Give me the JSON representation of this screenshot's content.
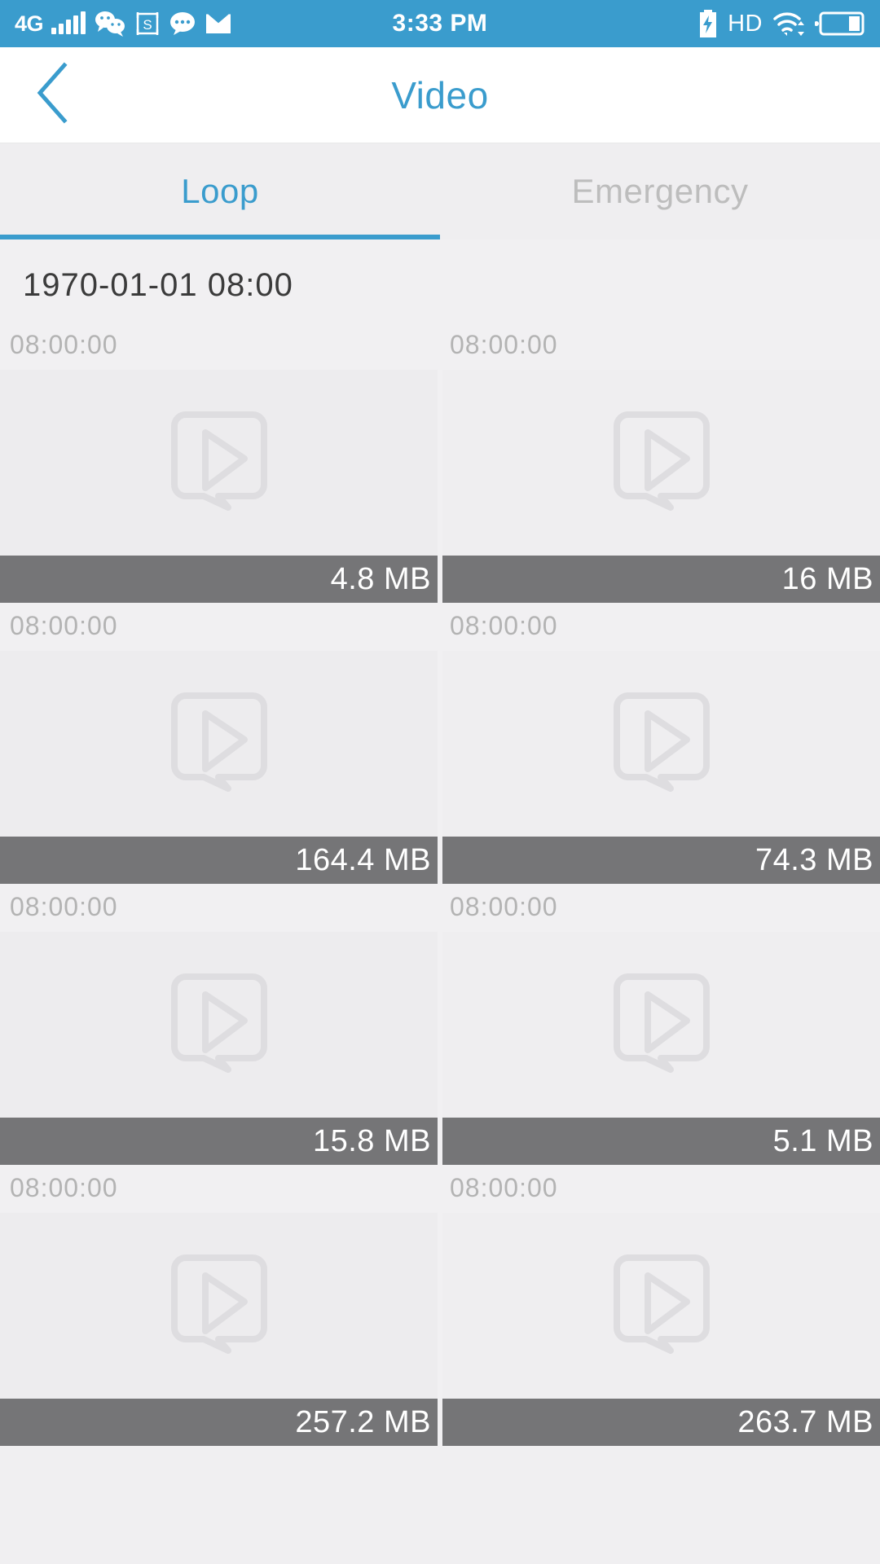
{
  "status_bar": {
    "network_type": "4G",
    "signal_icon": "signal-bars-icon",
    "wechat_icon": "wechat-icon",
    "sogou_icon": "sogou-input-icon",
    "sogou_letter": "S",
    "message_icon": "chat-bubble-icon",
    "mail_icon": "mail-icon",
    "time": "3:33 PM",
    "charging_icon": "battery-charging-icon",
    "hd_label": "HD",
    "wifi_icon": "wifi-icon",
    "battery_icon": "battery-icon",
    "background_color": "#3a9ccd"
  },
  "header": {
    "back_icon": "back-chevron-icon",
    "title": "Video",
    "accent_color": "#3a9ccd"
  },
  "tabs": [
    {
      "label": "Loop",
      "active": true
    },
    {
      "label": "Emergency",
      "active": false
    }
  ],
  "groups": [
    {
      "date": "1970-01-01 08:00",
      "items": [
        {
          "time": "08:00:00",
          "size": "4.8 MB",
          "thumb_icon": "video-placeholder-icon"
        },
        {
          "time": "08:00:00",
          "size": "16 MB",
          "thumb_icon": "video-placeholder-icon"
        },
        {
          "time": "08:00:00",
          "size": "164.4 MB",
          "thumb_icon": "video-placeholder-icon"
        },
        {
          "time": "08:00:00",
          "size": "74.3 MB",
          "thumb_icon": "video-placeholder-icon"
        },
        {
          "time": "08:00:00",
          "size": "15.8 MB",
          "thumb_icon": "video-placeholder-icon"
        },
        {
          "time": "08:00:00",
          "size": "5.1 MB",
          "thumb_icon": "video-placeholder-icon"
        },
        {
          "time": "08:00:00",
          "size": "257.2 MB",
          "thumb_icon": "video-placeholder-icon"
        },
        {
          "time": "08:00:00",
          "size": "263.7 MB",
          "thumb_icon": "video-placeholder-icon"
        }
      ]
    }
  ],
  "colors": {
    "accent": "#3a9ccd",
    "page_bg": "#f1f0f2",
    "footer_bar": "#757577",
    "muted_text": "#b3b3b3"
  }
}
